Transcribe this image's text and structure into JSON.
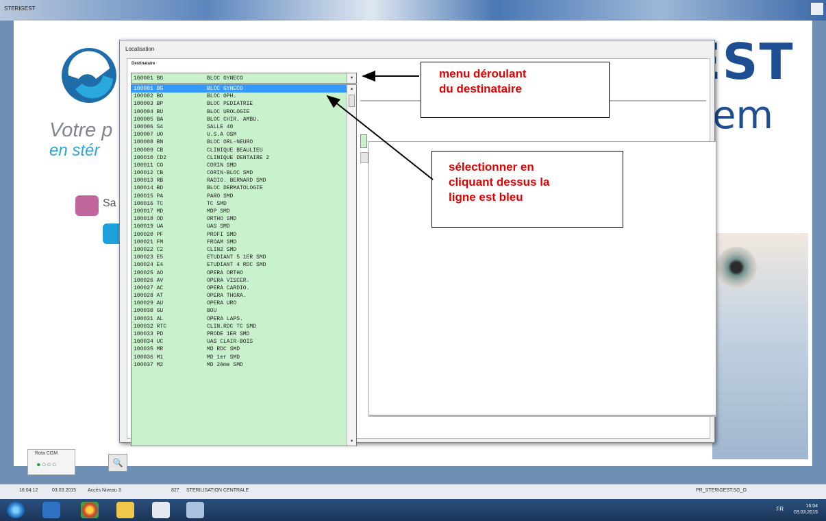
{
  "window": {
    "title": "STERIGEST"
  },
  "background": {
    "brand": "STERIGEST",
    "brand_suffix": "em",
    "tagline_line1": "Votre p",
    "tagline_line2": "en stér",
    "pink_label": "Sa"
  },
  "dialog": {
    "title": "Localisation",
    "destinataire_label": "Destinataire",
    "selected": {
      "code": "100001 BG",
      "name": "BLOC GYNECO"
    },
    "items": [
      {
        "code": "100001 BG",
        "name": "BLOC GYNECO",
        "selected": true
      },
      {
        "code": "100002 BO",
        "name": "BLOC OPH."
      },
      {
        "code": "100003 BP",
        "name": "BLOC PEDIATRIE"
      },
      {
        "code": "100004 BU",
        "name": "BLOC UROLOGIE"
      },
      {
        "code": "100005 BA",
        "name": "BLOC CHIR. AMBU."
      },
      {
        "code": "100006 S4",
        "name": "SALLE 40"
      },
      {
        "code": "100007 UO",
        "name": "U.S.A OSM"
      },
      {
        "code": "100008 BN",
        "name": "BLOC ORL-NEURO"
      },
      {
        "code": "100009 CB",
        "name": "CLINIQUE BEAULIEU"
      },
      {
        "code": "100010 CD2",
        "name": "CLINIQUE DENTAIRE 2"
      },
      {
        "code": "100011 CO",
        "name": "CORIN SMD"
      },
      {
        "code": "100012 CB",
        "name": "CORIN-BLOC SMD"
      },
      {
        "code": "100013 RB",
        "name": "RADIO. BERNARD SMD"
      },
      {
        "code": "100014 BD",
        "name": "BLOC DERMATOLOGIE"
      },
      {
        "code": "100015 PA",
        "name": "PARO SMD"
      },
      {
        "code": "100016 TC",
        "name": "TC SMD"
      },
      {
        "code": "100017 MD",
        "name": "MDP SMD"
      },
      {
        "code": "100018 OD",
        "name": "ORTHO SMD"
      },
      {
        "code": "100019 UA",
        "name": "UAS SMD"
      },
      {
        "code": "100020 PF",
        "name": "PROFI SMD"
      },
      {
        "code": "100021 FM",
        "name": "FROAM SMD"
      },
      {
        "code": "100022 C2",
        "name": "CLIN2 SMD"
      },
      {
        "code": "100023 E5",
        "name": "ETUDIANT 5 1ER SMD"
      },
      {
        "code": "100024 E4",
        "name": "ETUDIANT 4 RDC SMD"
      },
      {
        "code": "100025 AO",
        "name": "OPERA ORTHO"
      },
      {
        "code": "100026 AV",
        "name": "OPERA VISCER."
      },
      {
        "code": "100027 AC",
        "name": "OPERA CARDIO."
      },
      {
        "code": "100028 AT",
        "name": "OPERA THORA."
      },
      {
        "code": "100029 AU",
        "name": "OPERA URO"
      },
      {
        "code": "100030 GU",
        "name": "BOU"
      },
      {
        "code": "100031 AL",
        "name": "OPERA LAPS."
      },
      {
        "code": "100032 RTC",
        "name": "CLIN.RDC TC SMD"
      },
      {
        "code": "100033 PD",
        "name": "PRODE 1ER SMD"
      },
      {
        "code": "100034 UC",
        "name": "UAS CLAIR-BOIS"
      },
      {
        "code": "100035 MR",
        "name": "MD RDC SMD"
      },
      {
        "code": "100036 M1",
        "name": "MD 1er SMD"
      },
      {
        "code": "100037 M2",
        "name": "MD 2ème SMD"
      }
    ]
  },
  "annotations": {
    "callout1": "menu déroulant\ndu destinataire",
    "callout2": "sélectionner en\ncliquant dessus la\nligne est bleu"
  },
  "bottom": {
    "rota_label": "Rota CGM",
    "rota_dots": "●○○○"
  },
  "statusbar": {
    "time": "16:04:12",
    "date": "03.03.2015",
    "access": "Accès Niveau 3",
    "code": "827",
    "service": "STERILISATION CENTRALE",
    "db": "PR_STERIGEST:SG_O"
  },
  "taskbar": {
    "tray_lang": "FR",
    "clock_time": "16:04",
    "clock_date": "03.03.2015"
  },
  "colors": {
    "list_bg": "#c9f2cc",
    "selection": "#3399ff",
    "annotation_text": "#e30000",
    "brand": "#1e4e92"
  }
}
